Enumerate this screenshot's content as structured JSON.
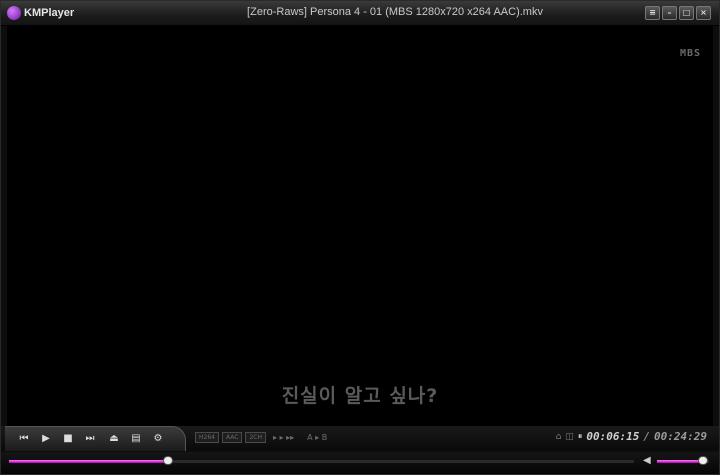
{
  "app": {
    "name": "KMPlayer"
  },
  "window": {
    "title": "[Zero-Raws] Persona 4 - 01 (MBS 1280x720 x264 AAC).mkv",
    "buttons": [
      {
        "icon": "menu-icon",
        "glyph": "≡"
      },
      {
        "icon": "minimize-icon",
        "glyph": "–"
      },
      {
        "icon": "maximize-icon",
        "glyph": "□"
      },
      {
        "icon": "close-icon",
        "glyph": "×"
      }
    ]
  },
  "video": {
    "channel_logo": "MBS",
    "subtitle": "진실이 알고 싶나?"
  },
  "controls": {
    "buttons": [
      {
        "icon": "previous-icon",
        "glyph": "⏮"
      },
      {
        "icon": "play-icon",
        "glyph": "▶"
      },
      {
        "icon": "stop-icon",
        "glyph": "■"
      },
      {
        "icon": "next-icon",
        "glyph": "⏭"
      },
      {
        "icon": "eject-icon",
        "glyph": "⏏"
      },
      {
        "icon": "playlist-icon",
        "glyph": "▤"
      },
      {
        "icon": "settings-icon",
        "glyph": "⚙"
      }
    ],
    "tags": [
      "H264",
      "AAC",
      "2CH"
    ],
    "speed_glyphs": "▸ ▸ ▸▸",
    "ab_label": "A ▸ B"
  },
  "status": {
    "current_time": "00:06:15",
    "separator": "/",
    "total_time": "00:24:29"
  },
  "progress": {
    "position_fraction": 0.255
  },
  "volume": {
    "level_fraction": 0.95
  },
  "colors": {
    "accent": "#d040d0",
    "background": "#000000"
  }
}
